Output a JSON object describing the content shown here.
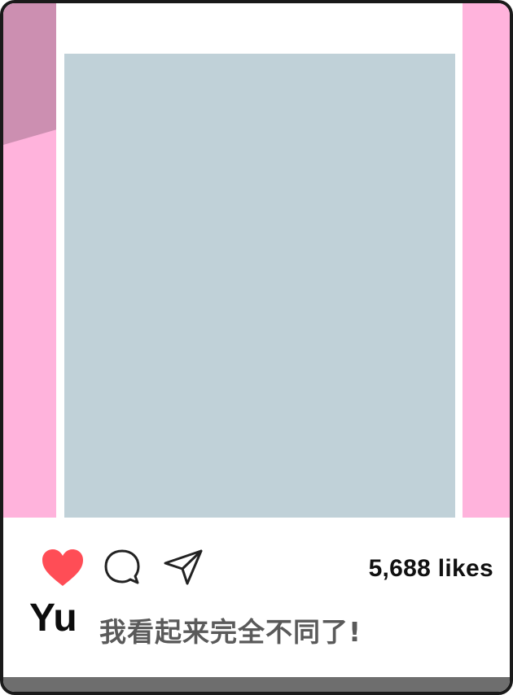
{
  "post": {
    "likes_text": "5,688 likes",
    "username": "Yu",
    "caption": "我看起来完全不同了!",
    "liked": true
  },
  "icons": {
    "like": "heart-icon",
    "comment": "comment-icon",
    "share": "send-icon"
  },
  "colors": {
    "background_pink": "#ffb3dc",
    "corner_mauve": "#cc8fb1",
    "photo_placeholder": "#c0d1d8",
    "heart_red": "#ff4d56",
    "caption_gray": "#5a5a5a"
  }
}
